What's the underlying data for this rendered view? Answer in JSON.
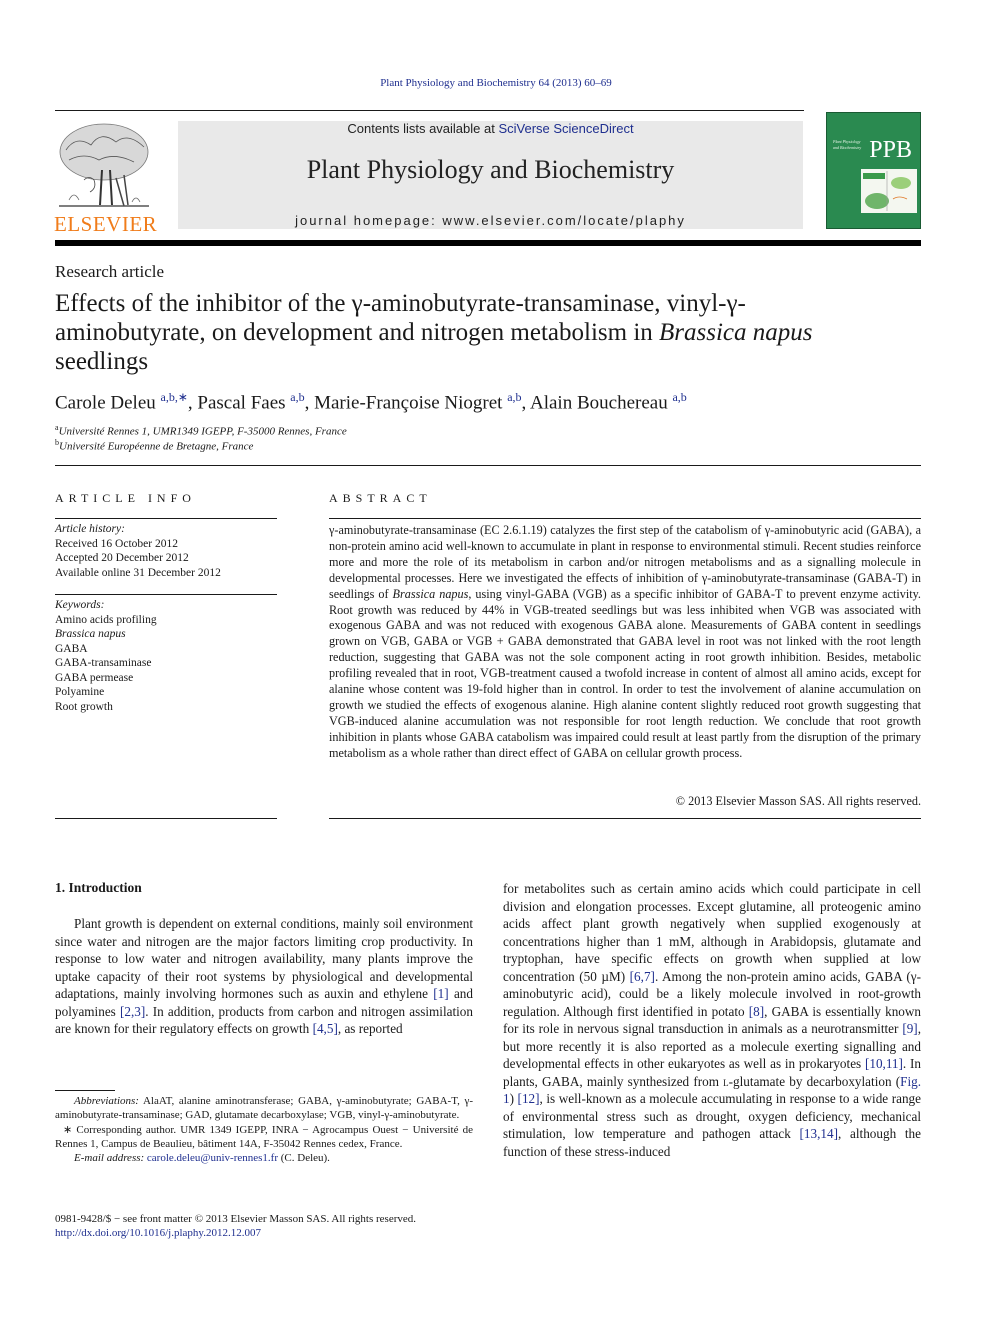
{
  "running_head": "Plant Physiology and Biochemistry 64 (2013) 60–69",
  "masthead": {
    "contents_prefix": "Contents lists available at ",
    "contents_link": "SciVerse ScienceDirect",
    "journal_title": "Plant Physiology and Biochemistry",
    "homepage": "journal homepage: www.elsevier.com/locate/plaphy",
    "publisher_logo_text": "ELSEVIER",
    "cover_abbrev": "PPB",
    "cover_small_text": "Plant Physiology and Biochemistry"
  },
  "colors": {
    "link": "#1f2f8f",
    "elsevier_orange": "#f07c1a",
    "cover_green": "#2a8a50",
    "masthead_gray": "#e9e9e9"
  },
  "article": {
    "section_type": "Research article",
    "title_part1": "Effects of the inhibitor of the γ-aminobutyrate-transaminase, vinyl-γ-aminobutyrate, on development and nitrogen metabolism in ",
    "title_italic": "Brassica napus",
    "title_part2": " seedlings",
    "authors": [
      {
        "name": "Carole Deleu",
        "sup": "a,b,∗",
        "sep": ", "
      },
      {
        "name": "Pascal Faes",
        "sup": "a,b",
        "sep": ", "
      },
      {
        "name": "Marie-Françoise Niogret",
        "sup": "a,b",
        "sep": ", "
      },
      {
        "name": "Alain Bouchereau",
        "sup": "a,b",
        "sep": ""
      }
    ],
    "affiliations": [
      {
        "mark": "a",
        "text": "Université Rennes 1, UMR1349 IGEPP, F-35000 Rennes, France"
      },
      {
        "mark": "b",
        "text": "Université Européenne de Bretagne, France"
      }
    ]
  },
  "article_info": {
    "heading": "ARTICLE INFO",
    "history_label": "Article history:",
    "history": [
      "Received 16 October 2012",
      "Accepted 20 December 2012",
      "Available online 31 December 2012"
    ],
    "keywords_label": "Keywords:",
    "keywords": [
      "Amino acids profiling",
      "Brassica napus",
      "GABA",
      "GABA-transaminase",
      "GABA permease",
      "Polyamine",
      "Root growth"
    ]
  },
  "abstract": {
    "heading": "ABSTRACT",
    "text_part1": "γ-aminobutyrate-transaminase (EC 2.6.1.19) catalyzes the first step of the catabolism of γ-aminobutyric acid (GABA), a non-protein amino acid well-known to accumulate in plant in response to environmental stimuli. Recent studies reinforce more and more the role of its metabolism in carbon and/or nitrogen metabolisms and as a signalling molecule in developmental processes. Here we investigated the effects of inhibition of γ-aminobutyrate-transaminase (GABA-T) in seedlings of ",
    "text_italic": "Brassica napus",
    "text_part2": ", using vinyl-GABA (VGB) as a specific inhibitor of GABA-T to prevent enzyme activity. Root growth was reduced by 44% in VGB-treated seedlings but was less inhibited when VGB was associated with exogenous GABA and was not reduced with exogenous GABA alone. Measurements of GABA content in seedlings grown on VGB, GABA or VGB + GABA demonstrated that GABA level in root was not linked with the root length reduction, suggesting that GABA was not the sole component acting in root growth inhibition. Besides, metabolic profiling revealed that in root, VGB-treatment caused a twofold increase in content of almost all amino acids, except for alanine whose content was 19-fold higher than in control. In order to test the involvement of alanine accumulation on growth we studied the effects of exogenous alanine. High alanine content slightly reduced root growth suggesting that VGB-induced alanine accumulation was not responsible for root length reduction. We conclude that root growth inhibition in plants whose GABA catabolism was impaired could result at least partly from the disruption of the primary metabolism as a whole rather than direct effect of GABA on cellular growth process.",
    "copyright": "© 2013 Elsevier Masson SAS. All rights reserved."
  },
  "introduction": {
    "heading": "1.  Introduction",
    "left_p1": "Plant growth is dependent on external conditions, mainly soil environment since water and nitrogen are the major factors limiting crop productivity. In response to low water and nitrogen availability, many plants improve the uptake capacity of their root systems by physiological and developmental adaptations, mainly involving hormones such as auxin and ethylene ",
    "ref_1": "[1]",
    "left_p2": " and polyamines ",
    "ref_2_3": "[2,3]",
    "left_p3": ". In addition, products from carbon and nitrogen assimilation are known for their regulatory effects on growth ",
    "ref_4_5": "[4,5]",
    "left_p4": ", as reported",
    "right_p1": "for metabolites such as certain amino acids which could participate in cell division and elongation processes. Except glutamine, all proteogenic amino acids affect plant growth negatively when supplied exogenously at concentrations higher than 1 mM, although in Arabidopsis, glutamate and tryptophan, have specific effects on growth when supplied at low concentration (50 µM) ",
    "ref_6_7": "[6,7]",
    "right_p2": ". Among the non-protein amino acids, GABA (γ-aminobutyric acid), could be a likely molecule involved in root-growth regulation. Although first identified in potato ",
    "ref_8": "[8]",
    "right_p3": ", GABA is essentially known for its role in nervous signal transduction in animals as a neurotransmitter ",
    "ref_9": "[9]",
    "right_p4": ", but more recently it is also reported as a molecule exerting signalling and developmental effects in other eukaryotes as well as in prokaryotes ",
    "ref_10_11": "[10,11]",
    "right_p5": ". In plants, GABA, mainly synthesized from ",
    "right_l": "l",
    "right_p6": "-glutamate by decarboxylation (",
    "fig_1": "Fig. 1",
    "right_p7": ") ",
    "ref_12": "[12]",
    "right_p8": ", is well-known as a molecule accumulating in response to a wide range of environmental stress such as drought, oxygen deficiency, mechanical stimulation, low temperature and pathogen attack ",
    "ref_13_14": "[13,14]",
    "right_p9": ", although the function of these stress-induced"
  },
  "footnotes": {
    "abbrev_label": "Abbreviations:",
    "abbrev_text": " AlaAT, alanine aminotransferase; GABA, γ-aminobutyrate; GABA-T, γ-aminobutyrate-transaminase; GAD, glutamate decarboxylase; VGB, vinyl-γ-aminobutyrate.",
    "corresponding": "∗ Corresponding author. UMR 1349 IGEPP, INRA − Agrocampus Ouest − Université de Rennes 1, Campus de Beaulieu, bâtiment 14A, F-35042 Rennes cedex, France.",
    "email_label": "E-mail address:",
    "email": "carole.deleu@univ-rennes1.fr",
    "email_suffix": " (C. Deleu)."
  },
  "front_matter": {
    "issn_line": "0981-9428/$ − see front matter © 2013 Elsevier Masson SAS. All rights reserved.",
    "doi": "http://dx.doi.org/10.1016/j.plaphy.2012.12.007"
  }
}
